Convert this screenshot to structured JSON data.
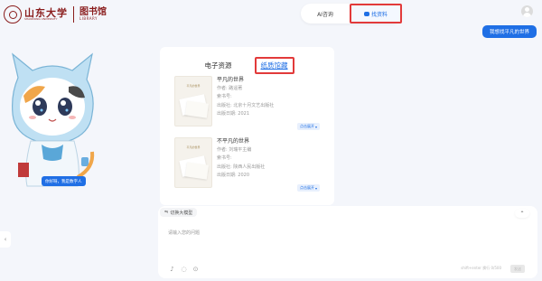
{
  "header": {
    "logo_cn": "山东大学",
    "logo_en": "SHANDONG UNIVERSITY",
    "library_cn": "图书馆",
    "library_en": "LIBRARY"
  },
  "mode_toggle": {
    "tabs": [
      {
        "label": "AI咨询",
        "active": false
      },
      {
        "label": "找资料",
        "active": true
      }
    ]
  },
  "user_message": "我想找平凡的世界",
  "mascot": {
    "greeting": "你好呀，我是数字人"
  },
  "panel": {
    "tabs": [
      {
        "label": "电子资源",
        "active": false
      },
      {
        "label": "纸质馆藏",
        "active": true
      }
    ],
    "books": [
      {
        "cover_title": "平凡的世界",
        "title": "平凡的世界",
        "author": "作者: 路遥著",
        "call_no": "索书号:",
        "publisher": "出版社: 北京十月文艺出版社",
        "date": "出版日期: 2021",
        "detail_label": "点击展开"
      },
      {
        "cover_title": "平凡的世界",
        "title": "不平凡的世界",
        "author": "作者: 刘瑞平主编",
        "call_no": "索书号:",
        "publisher": "出版社: 陕西人民出版社",
        "date": "出版日期: 2020",
        "detail_label": "点击展开"
      }
    ]
  },
  "input": {
    "model_switch_label": "切换大模型",
    "placeholder": "请输入您的问题",
    "char_count": "shift+enter 换行  0/500",
    "send_label": "发送"
  },
  "colors": {
    "accent": "#1f6fe5",
    "highlight_box": "#e23a3a",
    "brand": "#8a1c1c"
  }
}
